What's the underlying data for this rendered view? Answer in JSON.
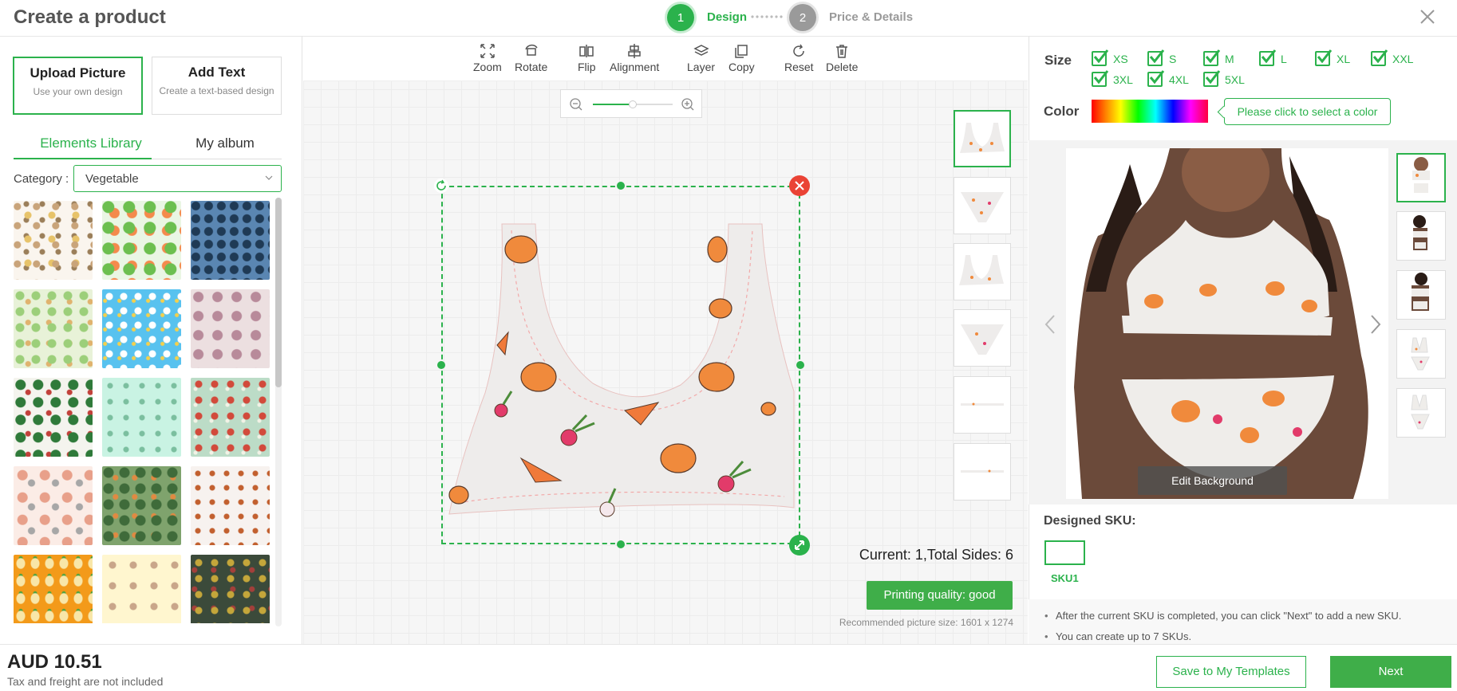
{
  "header": {
    "title": "Create a product",
    "steps": [
      {
        "number": "1",
        "label": "Design",
        "active": true
      },
      {
        "number": "2",
        "label": "Price & Details",
        "active": false
      }
    ],
    "close_icon": "close-icon"
  },
  "left": {
    "upload": {
      "title": "Upload Picture",
      "subtitle": "Use your own design"
    },
    "addtext": {
      "title": "Add Text",
      "subtitle": "Create a text-based design"
    },
    "tabs": [
      "Elements Library",
      "My album"
    ],
    "category_label": "Category :",
    "category_value": "Vegetable"
  },
  "toolbar": {
    "tools": [
      {
        "label": "Zoom",
        "icon": "zoom-icon"
      },
      {
        "label": "Rotate",
        "icon": "rotate-icon"
      },
      {
        "label": "Flip",
        "icon": "flip-icon"
      },
      {
        "label": "Alignment",
        "icon": "alignment-icon"
      },
      {
        "label": "Layer",
        "icon": "layer-icon"
      },
      {
        "label": "Copy",
        "icon": "copy-icon"
      },
      {
        "label": "Reset",
        "icon": "reset-icon"
      },
      {
        "label": "Delete",
        "icon": "delete-icon"
      }
    ]
  },
  "canvas": {
    "zoom_level": 0.5,
    "current_text": "Current: 1,Total Sides: 6",
    "quality": "Printing quality: good",
    "recommended": "Recommended picture size: 1601 x 1274"
  },
  "right": {
    "size_label": "Size",
    "sizes": [
      "XS",
      "S",
      "M",
      "L",
      "XL",
      "XXL",
      "3XL",
      "4XL",
      "5XL"
    ],
    "color_label": "Color",
    "color_hint": "Please click to select a color",
    "edit_background": "Edit Background",
    "designed_sku": "Designed SKU:",
    "sku_name": "SKU1",
    "notes": [
      "After the current SKU is completed, you can click \"Next\" to add a new SKU.",
      "You can create up to 7 SKUs."
    ]
  },
  "footer": {
    "price": "AUD 10.51",
    "price_note": "Tax and freight are not included",
    "save_label": "Save to My Templates",
    "next_label": "Next"
  },
  "colors": {
    "accent": "#2bb24c",
    "button": "#3fae49",
    "close_handle": "#ea4335"
  }
}
